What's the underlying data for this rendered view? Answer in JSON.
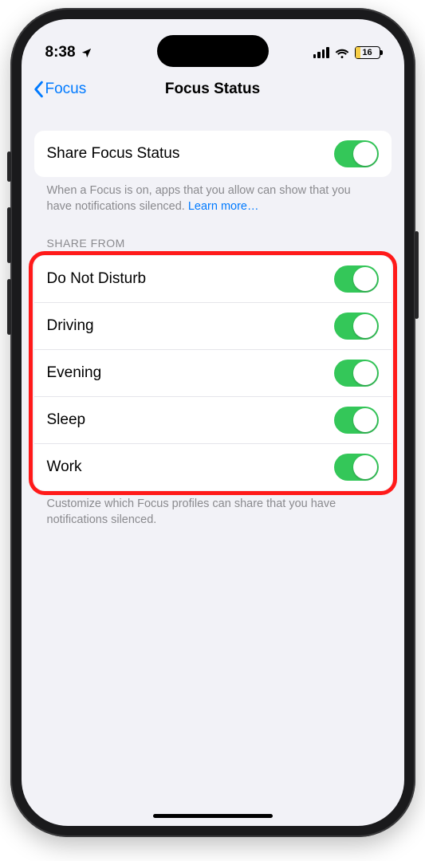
{
  "statusbar": {
    "time": "8:38",
    "battery_pct": "16"
  },
  "nav": {
    "back_label": "Focus",
    "title": "Focus Status"
  },
  "share_section": {
    "row_label": "Share Focus Status",
    "footer_text": "When a Focus is on, apps that you allow can show that you have notifications silenced. ",
    "learn_more": "Learn more…"
  },
  "share_from": {
    "header": "SHARE FROM",
    "items": [
      {
        "label": "Do Not Disturb"
      },
      {
        "label": "Driving"
      },
      {
        "label": "Evening"
      },
      {
        "label": "Sleep"
      },
      {
        "label": "Work"
      }
    ],
    "footer": "Customize which Focus profiles can share that you have notifications silenced."
  }
}
